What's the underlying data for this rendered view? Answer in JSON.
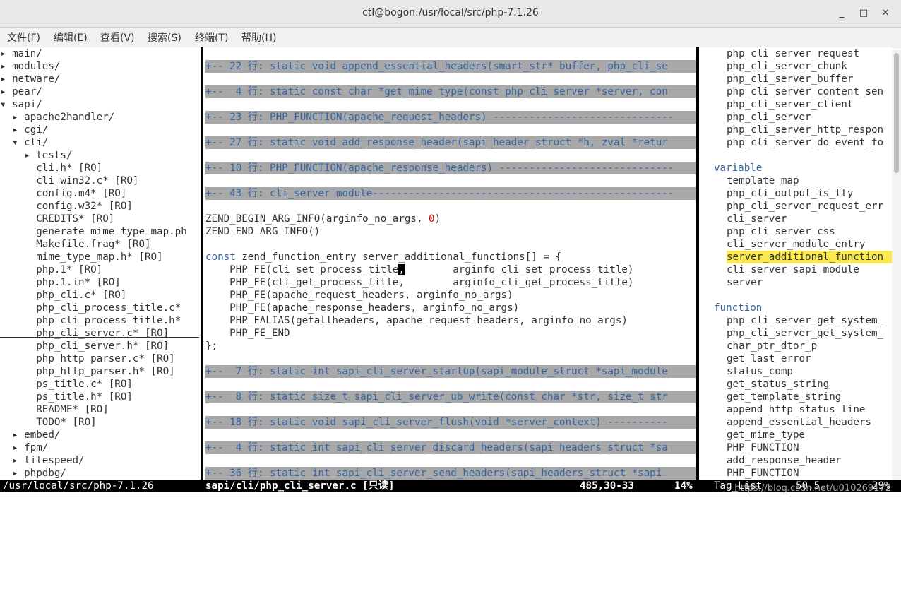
{
  "window": {
    "title": "ctl@bogon:/usr/local/src/php-7.1.26",
    "minimize": "_",
    "maximize": "□",
    "close": "✕"
  },
  "menu": [
    "文件(F)",
    "编辑(E)",
    "查看(V)",
    "搜索(S)",
    "终端(T)",
    "帮助(H)"
  ],
  "tree": [
    "▸ main/",
    "▸ modules/",
    "▸ netware/",
    "▸ pear/",
    "▾ sapi/",
    "  ▸ apache2handler/",
    "  ▸ cgi/",
    "  ▾ cli/",
    "    ▸ tests/",
    "      cli.h* [RO]",
    "      cli_win32.c* [RO]",
    "      config.m4* [RO]",
    "      config.w32* [RO]",
    "      CREDITS* [RO]",
    "      generate_mime_type_map.ph",
    "      Makefile.frag* [RO]",
    "      mime_type_map.h* [RO]",
    "      php.1* [RO]",
    "      php.1.in* [RO]",
    "      php_cli.c* [RO]",
    "      php_cli_process_title.c*",
    "      php_cli_process_title.h*",
    "      php_cli_server.c* [RO]",
    "      php_cli_server.h* [RO]",
    "      php_http_parser.c* [RO]",
    "      php_http_parser.h* [RO]",
    "      ps_title.c* [RO]",
    "      ps_title.h* [RO]",
    "      README* [RO]",
    "      TODO* [RO]",
    "  ▸ embed/",
    "  ▸ fpm/",
    "  ▸ litespeed/",
    "  ▸ phpdbg/"
  ],
  "code": {
    "folds_top": [
      "+-- 22 行: static void append_essential_headers(smart_str* buffer, php_cli_se",
      "+--  4 行: static const char *get_mime_type(const php_cli_server *server, con",
      "+-- 23 行: PHP_FUNCTION(apache_request_headers) ------------------------------",
      "+-- 27 行: static void add_response_header(sapi_header_struct *h, zval *retur",
      "+-- 10 行: PHP_FUNCTION(apache_response_headers) -----------------------------",
      "+-- 43 行: cli_server module--------------------------------------------------"
    ],
    "begin_arg": "ZEND_BEGIN_ARG_INFO(arginfo_no_args, ",
    "begin_arg_num": "0",
    "begin_arg_end": ")",
    "end_arg": "ZEND_END_ARG_INFO()",
    "const_kw": "const",
    "decl_rest": " zend_function_entry server_additional_functions[] = {",
    "fe1_a": "    PHP_FE(cli_set_process_title",
    "fe1_cursor": ",",
    "fe1_b": "        arginfo_cli_set_process_title)",
    "fe2": "    PHP_FE(cli_get_process_title,        arginfo_cli_get_process_title)",
    "fe3": "    PHP_FE(apache_request_headers, arginfo_no_args)",
    "fe4": "    PHP_FE(apache_response_headers, arginfo_no_args)",
    "fe5": "    PHP_FALIAS(getallheaders, apache_request_headers, arginfo_no_args)",
    "fe_end": "    PHP_FE_END",
    "close": "};",
    "folds_bottom": [
      "+--  7 行: static int sapi_cli_server_startup(sapi_module_struct *sapi_module",
      "+--  8 行: static size_t sapi_cli_server_ub_write(const char *str, size_t str",
      "+-- 18 行: static void sapi_cli_server_flush(void *server_context) ----------",
      "+--  4 行: static int sapi_cli_server_discard_headers(sapi_headers_struct *sa",
      "+-- 36 行: static int sapi_cli_server_send_headers(sapi_headers_struct *sapi "
    ]
  },
  "tags": {
    "top_items": [
      "php_cli_server_request",
      "php_cli_server_chunk",
      "php_cli_server_buffer",
      "php_cli_server_content_sen",
      "php_cli_server_client",
      "php_cli_server",
      "php_cli_server_http_respon",
      "php_cli_server_do_event_fo"
    ],
    "variable_header": "variable",
    "variables": [
      "template_map",
      "php_cli_output_is_tty",
      "php_cli_server_request_err",
      "cli_server",
      "php_cli_server_css",
      "cli_server_module_entry",
      "server_additional_function",
      "cli_server_sapi_module",
      "server"
    ],
    "selected_variable": "server_additional_function",
    "function_header": "function",
    "functions": [
      "php_cli_server_get_system_",
      "php_cli_server_get_system_",
      "char_ptr_dtor_p",
      "get_last_error",
      "status_comp",
      "get_status_string",
      "get_template_string",
      "append_http_status_line",
      "append_essential_headers",
      "get_mime_type",
      "PHP_FUNCTION",
      "add_response_header",
      "PHP_FUNCTION"
    ]
  },
  "status": {
    "tree_path": "/usr/local/src/php-7.1.26",
    "file": "sapi/cli/php_cli_server.c [只读]",
    "position": "485,30-33",
    "percent": "14%",
    "tag_list": "Tag_List",
    "tag_pos": "50,5",
    "tag_percent": "29%"
  },
  "watermark": "https://blog.csdn.net/u010269172"
}
